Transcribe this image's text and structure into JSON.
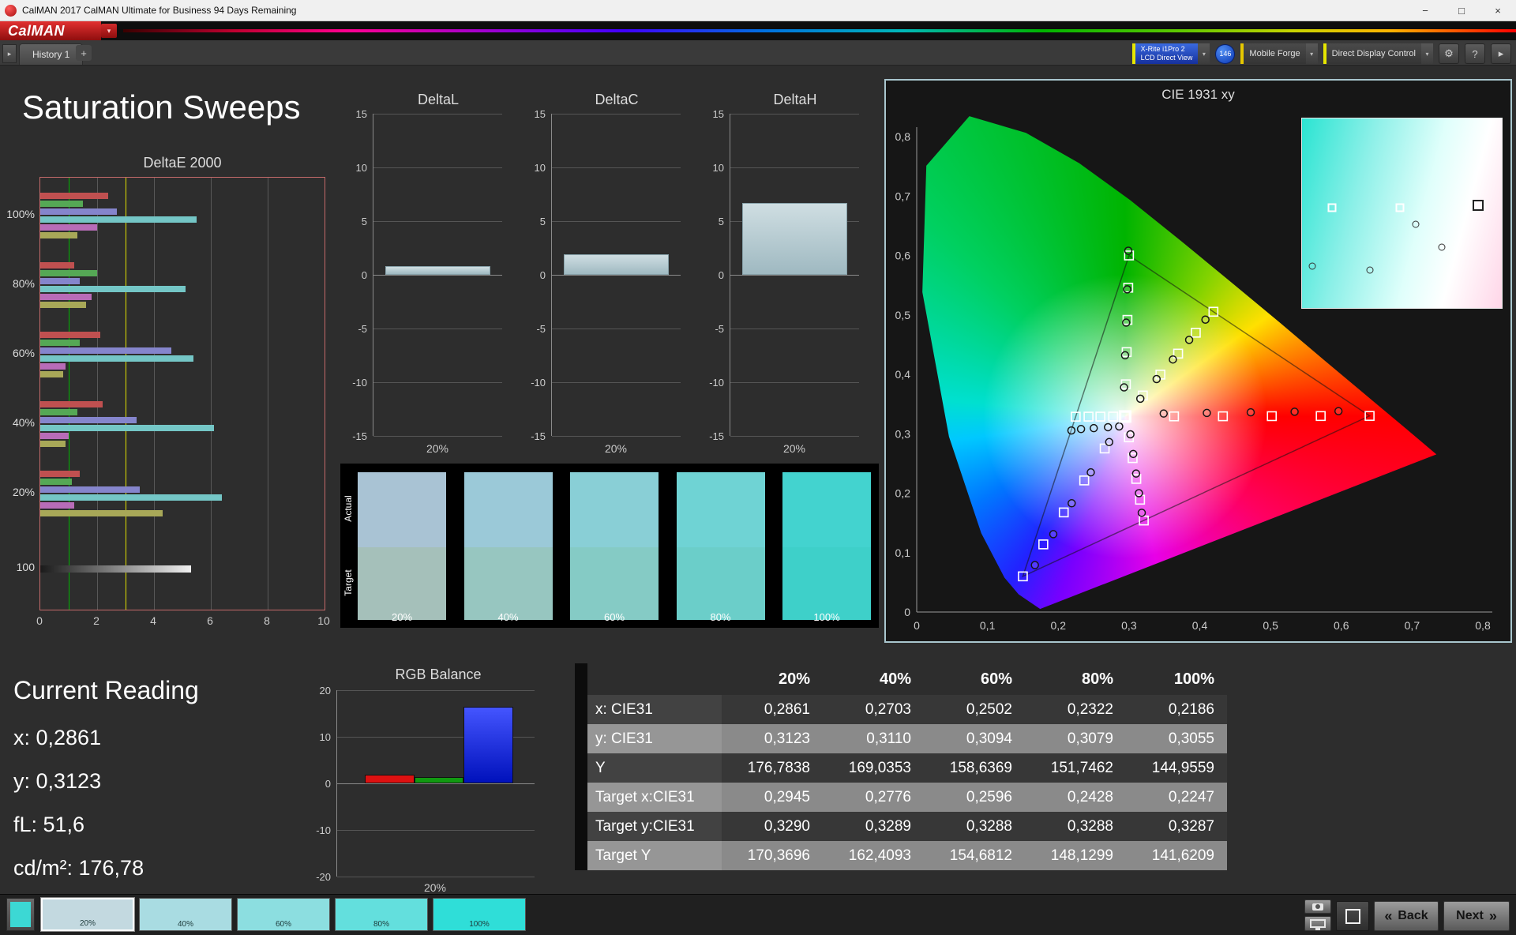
{
  "window": {
    "title": "CalMAN 2017 CalMAN Ultimate for Business 94 Days Remaining",
    "controls": {
      "minimize": "−",
      "maximize": "□",
      "close": "×"
    }
  },
  "brand": {
    "logo_text": "CalMAN",
    "accent_red": "#cc1f1f",
    "caret_icon": "▾"
  },
  "tab_bar": {
    "history_tab": "History 1",
    "add_tab": "+",
    "scroll_icon": "▸"
  },
  "toolbar": {
    "meter_button": {
      "line1": "X-Rite i1Pro 2",
      "line2": "LCD Direct View"
    },
    "badge_count": "146",
    "source_button": "Mobile Forge",
    "display_control_button": "Direct Display Control",
    "settings_icon": "⚙",
    "help_label": "?",
    "expand_icon": "▸",
    "caret_icon": "▾"
  },
  "page": {
    "title": "Saturation Sweeps"
  },
  "current_reading": {
    "title": "Current Reading",
    "x_line": "x: 0,2861",
    "y_line": "y: 0,3123",
    "fl_line": "fL: 51,6",
    "cd_line": "cd/m²: 176,78"
  },
  "swatch_strip": {
    "row_labels": [
      "Actual",
      "Target"
    ],
    "column_labels": [
      "20%",
      "40%",
      "60%",
      "80%",
      "100%"
    ],
    "actual_colors": [
      "#a9c3d4",
      "#9bc9d8",
      "#89cfd6",
      "#6fd3d4",
      "#43d3cf"
    ],
    "target_colors": [
      "#a5c0ba",
      "#97c6c0",
      "#85cbc5",
      "#6bcec9",
      "#3ed0c9"
    ]
  },
  "chart_data": [
    {
      "type": "bar",
      "title": "DeltaE 2000",
      "orientation": "horizontal",
      "xlim": [
        0,
        10
      ],
      "xticks": [
        0,
        2,
        4,
        6,
        8,
        10
      ],
      "reference_lines": [
        {
          "value": 1,
          "color": "#00b400"
        },
        {
          "value": 3,
          "color": "#e0e000"
        }
      ],
      "series_colors": {
        "red": "#c05050",
        "green": "#55a855",
        "blue": "#8585cc",
        "cyan": "#74c6c6",
        "magenta": "#b86cb8",
        "yellow": "#a8a858",
        "gray": "gray-gradient"
      },
      "groups": [
        {
          "label": "100%",
          "bars": [
            {
              "series": "red",
              "value": 2.4
            },
            {
              "series": "green",
              "value": 1.5
            },
            {
              "series": "blue",
              "value": 2.7
            },
            {
              "series": "cyan",
              "value": 5.5
            },
            {
              "series": "magenta",
              "value": 2.0
            },
            {
              "series": "yellow",
              "value": 1.3
            }
          ]
        },
        {
          "label": "80%",
          "bars": [
            {
              "series": "red",
              "value": 1.2
            },
            {
              "series": "green",
              "value": 2.0
            },
            {
              "series": "blue",
              "value": 1.4
            },
            {
              "series": "cyan",
              "value": 5.1
            },
            {
              "series": "magenta",
              "value": 1.8
            },
            {
              "series": "yellow",
              "value": 1.6
            }
          ]
        },
        {
          "label": "60%",
          "bars": [
            {
              "series": "red",
              "value": 2.1
            },
            {
              "series": "green",
              "value": 1.4
            },
            {
              "series": "blue",
              "value": 4.6
            },
            {
              "series": "cyan",
              "value": 5.4
            },
            {
              "series": "magenta",
              "value": 0.9
            },
            {
              "series": "yellow",
              "value": 0.8
            }
          ]
        },
        {
          "label": "40%",
          "bars": [
            {
              "series": "red",
              "value": 2.2
            },
            {
              "series": "green",
              "value": 1.3
            },
            {
              "series": "blue",
              "value": 3.4
            },
            {
              "series": "cyan",
              "value": 6.1
            },
            {
              "series": "magenta",
              "value": 1.0
            },
            {
              "series": "yellow",
              "value": 0.9
            }
          ]
        },
        {
          "label": "20%",
          "bars": [
            {
              "series": "red",
              "value": 1.4
            },
            {
              "series": "green",
              "value": 1.1
            },
            {
              "series": "blue",
              "value": 3.5
            },
            {
              "series": "cyan",
              "value": 6.4
            },
            {
              "series": "magenta",
              "value": 1.2
            },
            {
              "series": "yellow",
              "value": 4.3
            }
          ]
        },
        {
          "label": "100",
          "bars": [
            {
              "series": "gray",
              "value": 5.3
            }
          ]
        }
      ]
    },
    {
      "type": "bar",
      "title": "DeltaL",
      "ylim": [
        -15,
        15
      ],
      "yticks": [
        15,
        10,
        5,
        0,
        -5,
        -10,
        -15
      ],
      "categories": [
        "20%"
      ],
      "values": [
        0.8
      ],
      "bar_color": "#b7cdd2"
    },
    {
      "type": "bar",
      "title": "DeltaC",
      "ylim": [
        -15,
        15
      ],
      "yticks": [
        15,
        10,
        5,
        0,
        -5,
        -10,
        -15
      ],
      "categories": [
        "20%"
      ],
      "values": [
        1.9
      ],
      "bar_color": "#b7cdd2"
    },
    {
      "type": "bar",
      "title": "DeltaH",
      "ylim": [
        -15,
        15
      ],
      "yticks": [
        15,
        10,
        5,
        0,
        -5,
        -10,
        -15
      ],
      "categories": [
        "20%"
      ],
      "values": [
        6.7
      ],
      "bar_color": "#b7cdd2"
    },
    {
      "type": "bar",
      "title": "RGB Balance",
      "ylim": [
        -20,
        20
      ],
      "yticks": [
        20,
        10,
        0,
        -10,
        -20
      ],
      "categories": [
        "20%"
      ],
      "series": [
        {
          "name": "Red",
          "value": 1.9,
          "color": "#dd1111"
        },
        {
          "name": "Green",
          "value": 1.3,
          "color": "#119911"
        },
        {
          "name": "Blue",
          "value": 16.4,
          "color": "#1122dd"
        }
      ]
    },
    {
      "type": "scatter",
      "title": "CIE 1931 xy",
      "xlim": [
        0,
        0.8
      ],
      "ylim": [
        0,
        0.8
      ],
      "xticks": [
        "0",
        "0,1",
        "0,2",
        "0,3",
        "0,4",
        "0,5",
        "0,6",
        "0,7",
        "0,8"
      ],
      "yticks": [
        "0,8",
        "0,7",
        "0,6",
        "0,5",
        "0,4",
        "0,3",
        "0,2",
        "0,1",
        "0"
      ],
      "white_point": [
        0.2945,
        0.329
      ],
      "gamut_triangle": [
        [
          0.64,
          0.33
        ],
        [
          0.3,
          0.6
        ],
        [
          0.15,
          0.06
        ]
      ],
      "sweeps": {
        "red": {
          "targets": [
            [
              0.3636,
              0.3292
            ],
            [
              0.4327,
              0.3294
            ],
            [
              0.5018,
              0.3296
            ],
            [
              0.5709,
              0.3298
            ],
            [
              0.64,
              0.33
            ]
          ],
          "measured": [
            [
              0.349,
              0.334
            ],
            [
              0.41,
              0.335
            ],
            [
              0.472,
              0.336
            ],
            [
              0.534,
              0.337
            ],
            [
              0.596,
              0.338
            ]
          ]
        },
        "green": {
          "targets": [
            [
              0.2956,
              0.3832
            ],
            [
              0.2967,
              0.4374
            ],
            [
              0.2978,
              0.4916
            ],
            [
              0.2989,
              0.5458
            ],
            [
              0.3,
              0.6
            ]
          ],
          "measured": [
            [
              0.293,
              0.378
            ],
            [
              0.2945,
              0.432
            ],
            [
              0.296,
              0.487
            ],
            [
              0.2975,
              0.543
            ],
            [
              0.299,
              0.608
            ]
          ]
        },
        "blue": {
          "targets": [
            [
              0.2656,
              0.2752
            ],
            [
              0.2367,
              0.2214
            ],
            [
              0.2078,
              0.1676
            ],
            [
              0.1789,
              0.1138
            ],
            [
              0.15,
              0.06
            ]
          ],
          "measured": [
            [
              0.272,
              0.286
            ],
            [
              0.246,
              0.235
            ],
            [
              0.219,
              0.183
            ],
            [
              0.193,
              0.131
            ],
            [
              0.167,
              0.079
            ]
          ]
        },
        "cyan": {
          "targets": [
            [
              0.2945,
              0.329
            ],
            [
              0.2776,
              0.3289
            ],
            [
              0.2596,
              0.3288
            ],
            [
              0.2428,
              0.3288
            ],
            [
              0.2247,
              0.3287
            ]
          ],
          "measured": [
            [
              0.2861,
              0.3123
            ],
            [
              0.2703,
              0.311
            ],
            [
              0.2502,
              0.3094
            ],
            [
              0.2322,
              0.3079
            ],
            [
              0.2186,
              0.3055
            ]
          ]
        },
        "magenta": {
          "targets": [
            [
              0.2998,
              0.294
            ],
            [
              0.3051,
              0.259
            ],
            [
              0.3103,
              0.224
            ],
            [
              0.3156,
              0.189
            ],
            [
              0.3209,
              0.154
            ]
          ],
          "measured": [
            [
              0.302,
              0.299
            ],
            [
              0.306,
              0.266
            ],
            [
              0.31,
              0.233
            ],
            [
              0.314,
              0.2
            ],
            [
              0.318,
              0.167
            ]
          ]
        },
        "yellow": {
          "targets": [
            [
              0.3195,
              0.3643
            ],
            [
              0.3444,
              0.3995
            ],
            [
              0.3694,
              0.4348
            ],
            [
              0.3944,
              0.47
            ],
            [
              0.4193,
              0.5053
            ]
          ],
          "measured": [
            [
              0.316,
              0.359
            ],
            [
              0.339,
              0.392
            ],
            [
              0.362,
              0.425
            ],
            [
              0.385,
              0.458
            ],
            [
              0.408,
              0.492
            ]
          ]
        }
      },
      "inset": {
        "squares": [
          [
            0.15,
            0.47
          ],
          [
            0.49,
            0.47
          ]
        ],
        "highlight_square": [
          0.88,
          0.46
        ],
        "circles": [
          [
            0.7,
            0.68
          ],
          [
            0.34,
            0.8
          ],
          [
            0.57,
            0.56
          ],
          [
            0.05,
            0.78
          ]
        ]
      }
    },
    {
      "type": "table",
      "headers": [
        "",
        "20%",
        "40%",
        "60%",
        "80%",
        "100%"
      ],
      "rows": [
        {
          "label": "x: CIE31",
          "values": [
            "0,2861",
            "0,2703",
            "0,2502",
            "0,2322",
            "0,2186"
          ]
        },
        {
          "label": "y: CIE31",
          "values": [
            "0,3123",
            "0,3110",
            "0,3094",
            "0,3079",
            "0,3055"
          ]
        },
        {
          "label": "Y",
          "values": [
            "176,7838",
            "169,0353",
            "158,6369",
            "151,7462",
            "144,9559"
          ]
        },
        {
          "label": "Target x:CIE31",
          "values": [
            "0,2945",
            "0,2776",
            "0,2596",
            "0,2428",
            "0,2247"
          ]
        },
        {
          "label": "Target y:CIE31",
          "values": [
            "0,3290",
            "0,3289",
            "0,3288",
            "0,3288",
            "0,3287"
          ]
        },
        {
          "label": "Target Y",
          "values": [
            "170,3696",
            "162,4093",
            "154,6812",
            "148,1299",
            "141,6209"
          ]
        }
      ]
    }
  ],
  "bottom_bar": {
    "patch_color": "#3cd8d4",
    "swatches": [
      {
        "label": "20%",
        "color": "#c3d9e0",
        "selected": true
      },
      {
        "label": "40%",
        "color": "#a9dce2",
        "selected": false
      },
      {
        "label": "60%",
        "color": "#8cdee0",
        "selected": false
      },
      {
        "label": "80%",
        "color": "#63dfdd",
        "selected": false
      },
      {
        "label": "100%",
        "color": "#2fded8",
        "selected": false
      }
    ],
    "back_label": "Back",
    "next_label": "Next",
    "back_arrow": "«",
    "next_arrow": "»"
  }
}
